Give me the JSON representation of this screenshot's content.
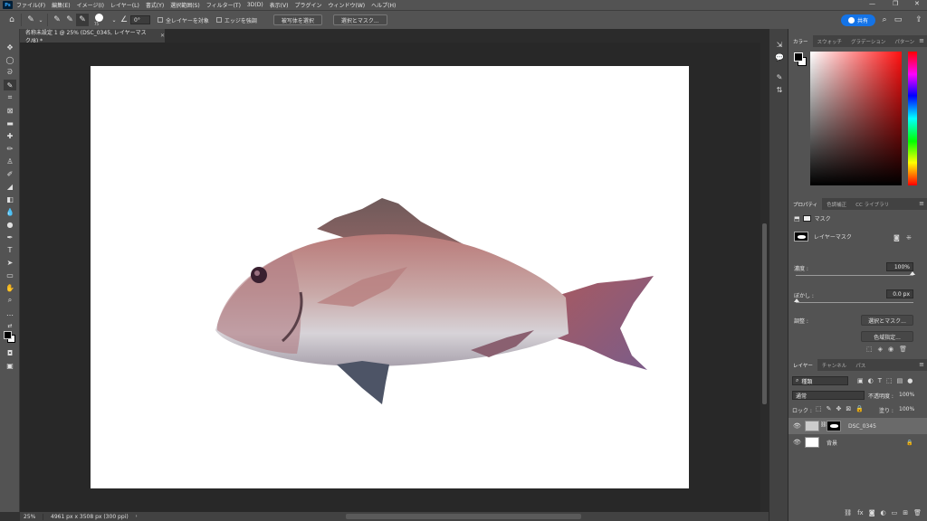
{
  "menubar": {
    "items": [
      "ファイル(F)",
      "編集(E)",
      "イメージ(I)",
      "レイヤー(L)",
      "書式(Y)",
      "選択範囲(S)",
      "フィルター(T)",
      "3D(D)",
      "表示(V)",
      "プラグイン",
      "ウィンドウ(W)",
      "ヘルプ(H)"
    ],
    "logo": "Ps"
  },
  "optbar": {
    "brush_size": "75",
    "angle": "0°",
    "sample_all_layers": "全レイヤーを対象",
    "enhance_edge": "エッジを強調",
    "select_subject": "被写体を選択",
    "select_and_mask": "選択とマスク...",
    "share": "共有"
  },
  "document": {
    "tab_title": "名称未設定 1 @ 25% (DSC_0345, レイヤーマスク/8) *",
    "zoom": "25%",
    "info": "4961 px x 3508 px (300 ppi)"
  },
  "color_panel": {
    "tabs": [
      "カラー",
      "スウォッチ",
      "グラデーション",
      "パターン"
    ],
    "foreground": "#000000",
    "background": "#ffffff"
  },
  "properties_panel": {
    "tabs": [
      "プロパティ",
      "色調補正",
      "CC ライブラリ"
    ],
    "mask_label": "マスク",
    "layer_mask_label": "レイヤーマスク",
    "density_label": "濃度 :",
    "density_value": "100%",
    "feather_label": "ぼかし :",
    "feather_value": "0.0 px",
    "refine_label": "調整 :",
    "select_and_mask_btn": "選択とマスク...",
    "color_range_btn": "色域指定..."
  },
  "layers_panel": {
    "tabs": [
      "レイヤー",
      "チャンネル",
      "パス"
    ],
    "filter_kind": "種類",
    "blend_mode": "通常",
    "opacity_label": "不透明度 :",
    "opacity_value": "100%",
    "lock_label": "ロック :",
    "fill_label": "塗り :",
    "fill_value": "100%",
    "layers": [
      {
        "name": "DSC_0345",
        "selected": true
      },
      {
        "name": "背景",
        "selected": false
      }
    ]
  }
}
